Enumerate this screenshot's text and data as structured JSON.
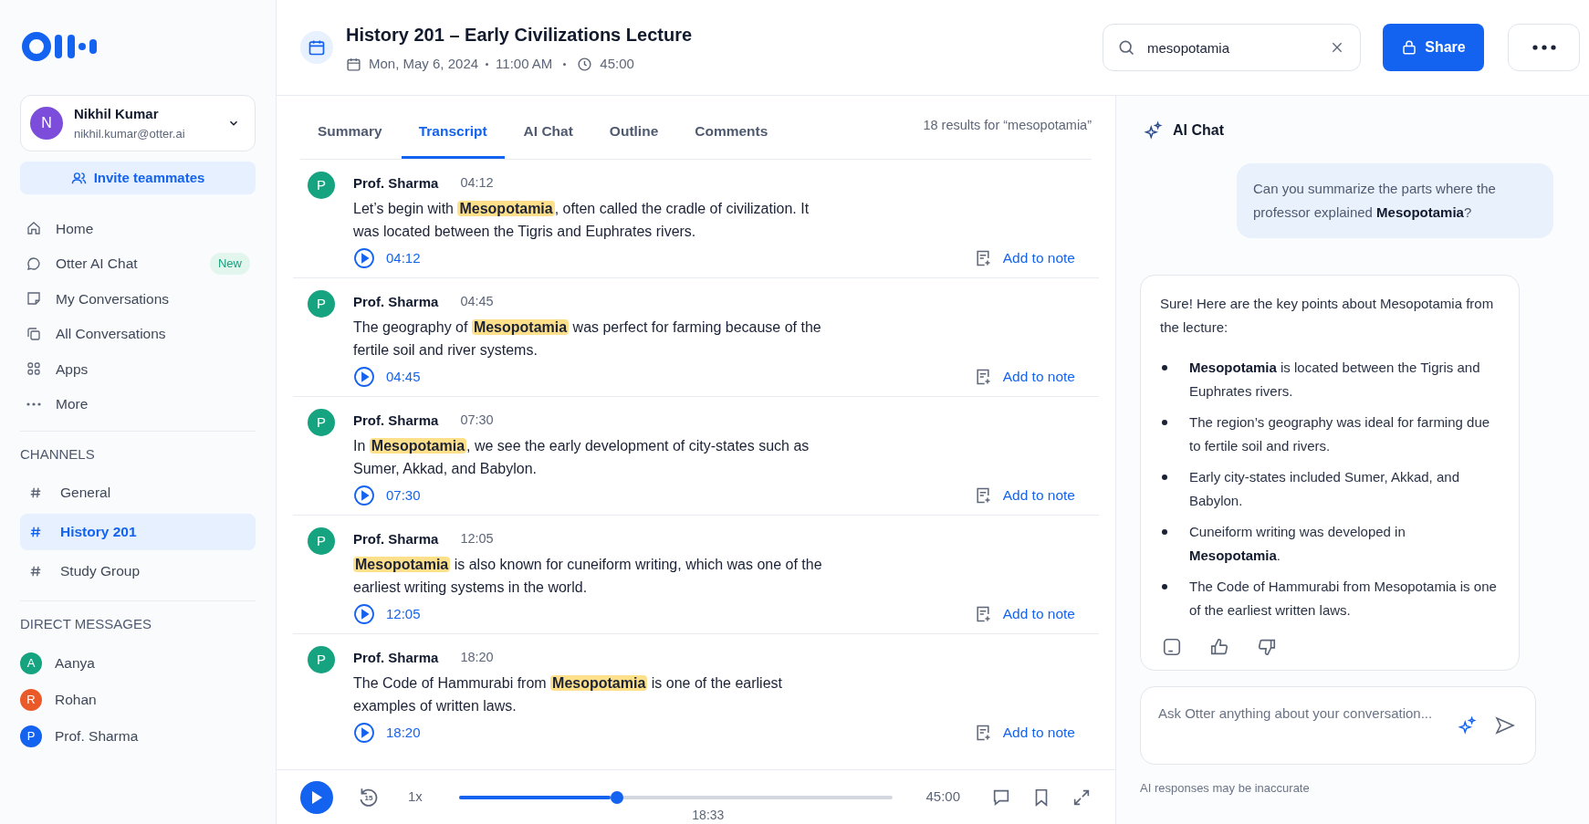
{
  "user": {
    "initial": "N",
    "name": "Nikhil Kumar",
    "email": "nikhil.kumar@otter.ai"
  },
  "invite_button": "Invite teammates",
  "nav": [
    {
      "kind": "home",
      "label": "Home"
    },
    {
      "kind": "chat",
      "label": "Otter AI Chat",
      "badge": "New"
    },
    {
      "kind": "conversation",
      "label": "My Conversations"
    },
    {
      "kind": "stack",
      "label": "All Conversations"
    },
    {
      "kind": "apps",
      "label": "Apps"
    },
    {
      "kind": "more",
      "label": "More"
    }
  ],
  "channels": {
    "heading": "CHANNELS",
    "items": [
      {
        "label": "General",
        "selected": false
      },
      {
        "label": "History 201",
        "selected": true
      },
      {
        "label": "Study Group",
        "selected": false
      }
    ]
  },
  "direct_messages": {
    "heading": "DIRECT MESSAGES",
    "items": [
      {
        "initial": "A",
        "name": "Aanya",
        "color": "#16a37f"
      },
      {
        "initial": "R",
        "name": "Rohan",
        "color": "#ea5a28"
      },
      {
        "initial": "P",
        "name": "Prof. Sharma",
        "color": "#1463f0"
      }
    ]
  },
  "header": {
    "title": "History 201 – Early Civilizations Lecture",
    "date": "Mon, May 6, 2024",
    "time": "11:00 AM",
    "duration": "45:00"
  },
  "search": {
    "value": "mesopotamia"
  },
  "share_button": "Share",
  "tabs": [
    {
      "label": "Summary",
      "selected": false
    },
    {
      "label": "Transcript",
      "selected": true
    },
    {
      "label": "AI Chat",
      "selected": false
    },
    {
      "label": "Outline",
      "selected": false
    },
    {
      "label": "Comments",
      "selected": false
    }
  ],
  "results": "18 results for “mesopotamia”",
  "transcript": [
    {
      "initial": "P",
      "speaker": "Prof. Sharma",
      "time": "04:12",
      "text": "Let’s begin with **Mesopotamia**, often called the cradle of civilization. It was located between the Tigris and Euphrates rivers.",
      "play_time": "04:12",
      "action": "Add to note"
    },
    {
      "initial": "P",
      "speaker": "Prof. Sharma",
      "time": "04:45",
      "text": "The geography of **Mesopotamia** was perfect for farming because of the fertile soil and river systems.",
      "play_time": "04:45",
      "action": "Add to note"
    },
    {
      "initial": "P",
      "speaker": "Prof. Sharma",
      "time": "07:30",
      "text": "In **Mesopotamia**, we see the early development of city-states such as Sumer, Akkad, and Babylon.",
      "play_time": "07:30",
      "action": "Add to note"
    },
    {
      "initial": "P",
      "speaker": "Prof. Sharma",
      "time": "12:05",
      "text": "**Mesopotamia** is also known for cuneiform writing, which was one of the earliest writing systems in the world.",
      "play_time": "12:05",
      "action": "Add to note"
    },
    {
      "initial": "P",
      "speaker": "Prof. Sharma",
      "time": "18:20",
      "text": "The Code of Hammurabi from **Mesopotamia** is one of the earliest examples of written laws.",
      "play_time": "18:20",
      "action": "Add to note"
    }
  ],
  "player": {
    "skip": "15",
    "speed": "1x",
    "level": 0.364,
    "current": "18:33",
    "total": "45:00"
  },
  "ai_chat": {
    "title": "AI Chat",
    "question": "Can you summarize the parts where the professor explained **Mesopotamia**?",
    "answer_intro": "Sure! Here are the key points about Mesopotamia from the lecture:",
    "answer_points": [
      "**Mesopotamia** is located between the Tigris and Euphrates rivers.",
      "The region’s geography was ideal for farming due to fertile soil and rivers.",
      "Early city-states included Sumer, Akkad, and Babylon.",
      "Cuneiform writing was developed in **Mesopotamia**.",
      "The Code of Hammurabi from Mesopotamia is one of the earliest written laws."
    ],
    "input_placeholder": "Ask Otter anything about your conversation...",
    "disclaimer": "AI responses may be inaccurate"
  }
}
